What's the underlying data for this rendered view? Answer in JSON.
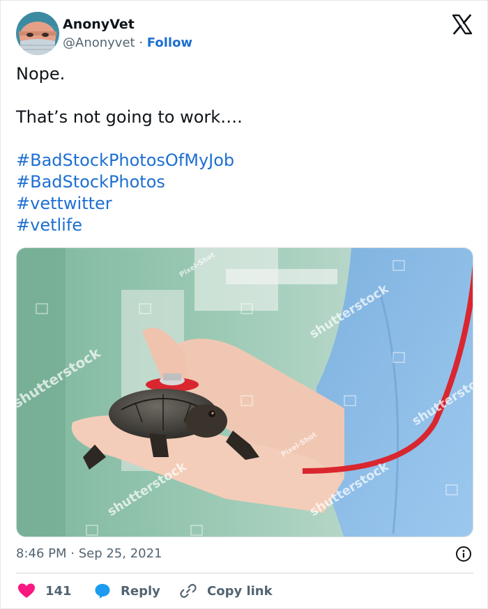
{
  "author": {
    "name": "AnonyVet",
    "handle": "@Anonyvet",
    "separator": "·",
    "follow_label": "Follow",
    "avatar_icon": "vet-avatar-icon"
  },
  "platform_icon": "x-logo-icon",
  "tweet": {
    "lines": [
      "Nope.",
      "That’s not going to work…."
    ],
    "hashtags": [
      "#BadStockPhotosOfMyJob",
      "#BadStockPhotos",
      "#vettwitter",
      "#vetlife"
    ]
  },
  "media": {
    "watermarks": [
      "shutterstock",
      "shutterstock",
      "shutterstock",
      "shutterstock",
      "shutterstock",
      "Pixel-Shot",
      "Pixel-Shot"
    ]
  },
  "meta": {
    "timestamp": "8:46 PM · Sep 25, 2021",
    "info_icon": "info-icon"
  },
  "actions": {
    "like_count": "141",
    "reply_label": "Reply",
    "copy_label": "Copy link"
  },
  "colors": {
    "link": "#1d6fd1",
    "heart": "#f91880",
    "reply": "#1d9bf0",
    "muted": "#536471"
  }
}
